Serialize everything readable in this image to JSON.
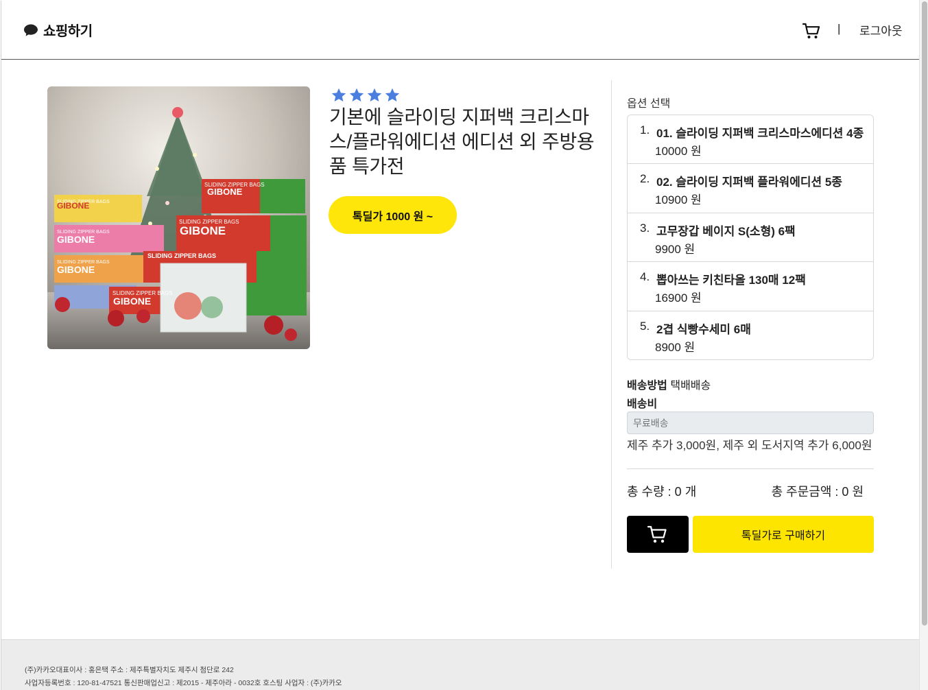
{
  "header": {
    "brand_label": "쇼핑하기",
    "separator": "|",
    "logout_label": "로그아웃"
  },
  "product": {
    "rating": 4,
    "title": "기본에 슬라이딩 지퍼백 크리스마스/플라워에디션 에디션 외 주방용품 특가전",
    "deal_button_label": "톡딜가 1000 원 ~",
    "image_text": {
      "sliding_zipper_bags": "SLIDING ZIPPER BAGS",
      "brand": "GIBONE"
    }
  },
  "options": {
    "heading": "옵션 선택",
    "items": [
      {
        "index": "1.",
        "name": "01. 슬라이딩 지퍼백 크리스마스에디션 4종",
        "price": "10000 원"
      },
      {
        "index": "2.",
        "name": "02. 슬라이딩 지퍼백 플라워에디션 5종",
        "price": "10900 원"
      },
      {
        "index": "3.",
        "name": "고무장갑 베이지 S(소형) 6팩",
        "price": "9900 원"
      },
      {
        "index": "4.",
        "name": "뽑아쓰는 키친타올 130매 12팩",
        "price": "16900 원"
      },
      {
        "index": "5.",
        "name": "2겹 식빵수세미 6매",
        "price": "8900 원"
      }
    ]
  },
  "delivery": {
    "method_label": "배송방법",
    "method_value": "택배배송",
    "fee_label": "배송비",
    "fee_placeholder": "무료배송",
    "fee_note": "제주 추가 3,000원, 제주 외 도서지역 추가 6,000원"
  },
  "totals": {
    "quantity": "총 수량 : 0 개",
    "amount": "총 주문금액 : 0 원"
  },
  "actions": {
    "buy_label": "톡딜가로 구매하기"
  },
  "footer": {
    "line1": "(주)카카오대표이사 : 홍은택 주소 : 제주특별자치도 제주시 첨단로 242",
    "line2": "사업자등록번호 : 120-81-47521 통신판매업신고 : 제2015 - 제주아라 - 0032호 호스팅 사업자 : (주)카카오",
    "line3": ""
  },
  "colors": {
    "accent_yellow": "#fee500",
    "star_blue": "#3b82f6",
    "footer_bg": "#ececec"
  }
}
